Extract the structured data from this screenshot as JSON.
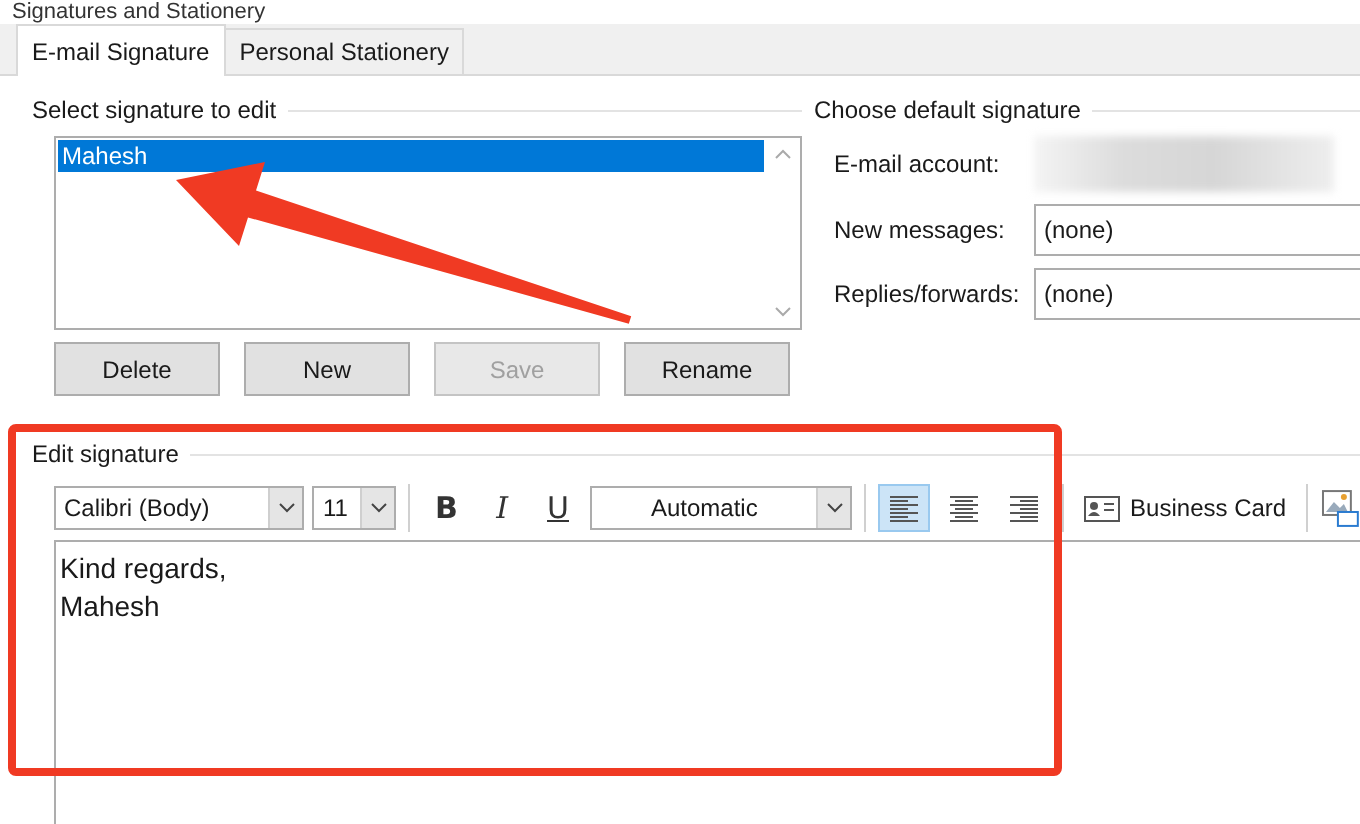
{
  "window": {
    "title": "Signatures and Stationery"
  },
  "tabs": [
    {
      "label": "E-mail Signature",
      "selected": true
    },
    {
      "label": "Personal Stationery",
      "selected": false
    }
  ],
  "select_signature": {
    "label": "Select signature to edit",
    "items": [
      {
        "label": "Mahesh",
        "selected": true
      }
    ],
    "buttons": [
      {
        "label": "Delete",
        "disabled": false
      },
      {
        "label": "New",
        "disabled": false
      },
      {
        "label": "Save",
        "disabled": true
      },
      {
        "label": "Rename",
        "disabled": false
      }
    ]
  },
  "default_signature": {
    "label": "Choose default signature",
    "fields": [
      {
        "label": "E-mail account:",
        "kind": "blurred"
      },
      {
        "label": "New messages:",
        "kind": "select",
        "value": "(none)"
      },
      {
        "label": "Replies/forwards:",
        "kind": "select",
        "value": "(none)"
      }
    ]
  },
  "edit_signature": {
    "label": "Edit signature",
    "font": "Calibri (Body)",
    "size": "11",
    "format_buttons": [
      {
        "label": "B",
        "kind": "bold"
      },
      {
        "label": "I",
        "kind": "italic"
      },
      {
        "label": "U",
        "kind": "underline"
      }
    ],
    "color_dropdown": "Automatic",
    "alignment": [
      {
        "kind": "left",
        "selected": true
      },
      {
        "kind": "center",
        "selected": false
      },
      {
        "kind": "right",
        "selected": false
      }
    ],
    "business_card": "Business Card",
    "body": [
      "Kind regards,",
      "Mahesh"
    ]
  }
}
